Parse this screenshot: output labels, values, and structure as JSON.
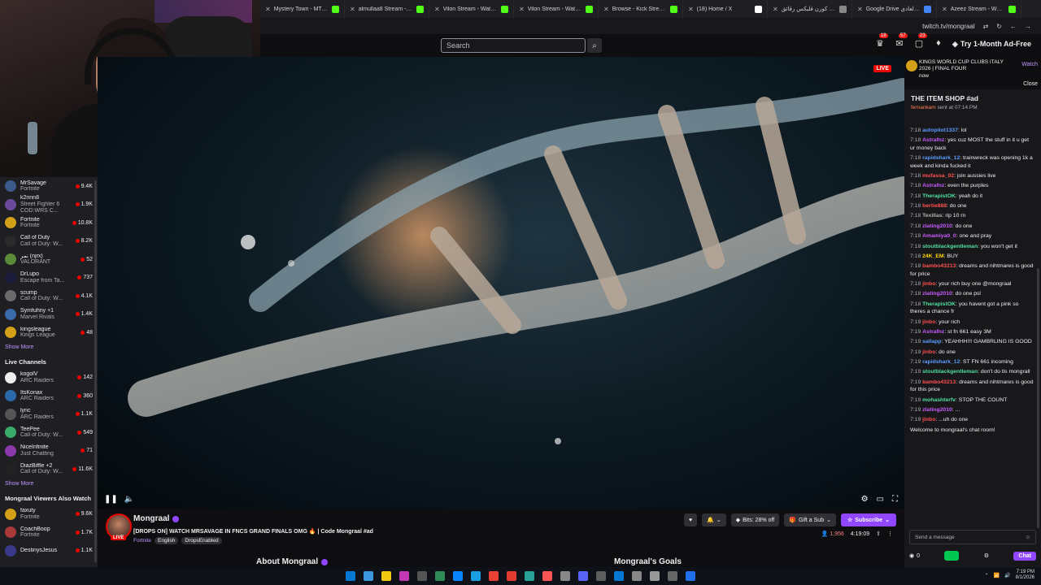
{
  "browser": {
    "tabs": [
      {
        "label": "Mystery Town - MT Studio",
        "color": "#53fc18"
      },
      {
        "label": "almullaa8 Stream - Watch Live",
        "color": "#53fc18"
      },
      {
        "label": "Vilon Stream - Watch Live",
        "color": "#53fc18"
      },
      {
        "label": "Vilon Stream - Watch Live",
        "color": "#53fc18"
      },
      {
        "label": "Browse - Kick Streaming",
        "color": "#53fc18"
      },
      {
        "label": "(18) Home / X",
        "color": "#ffffff"
      },
      {
        "label": "كورنيز كورن فليكس رقائق",
        "color": "#888888"
      },
      {
        "label": "Google Drive منيو العادي",
        "color": "#4285f4"
      },
      {
        "label": "Azeez Stream - Watch Live",
        "color": "#53fc18"
      }
    ],
    "url": "twitch.tv/mongraal"
  },
  "topnav": {
    "search_placeholder": "Search",
    "badge_1": "18",
    "badge_2": "57",
    "badge_3": "23",
    "ad_free_label": "Try 1-Month Ad-Free"
  },
  "sidebar": {
    "followed": [
      {
        "name": "MrSavage",
        "game": "Fortnite",
        "viewers": "9.4K",
        "color": "#3a5a8a"
      },
      {
        "name": "k2nnn8",
        "game": "Street Fighter 6",
        "extra": "COD:WRS C...",
        "viewers": "1.9K",
        "color": "#6a4a9a"
      },
      {
        "name": "Fortnite",
        "game": "Fortnite",
        "viewers": "10.8K",
        "color": "#d4a017"
      },
      {
        "name": "Call of Duty",
        "game": "Call of Duty: W...",
        "viewers": "8.2K",
        "color": "#2a2a2a"
      },
      {
        "name": "نمر (njrx)",
        "game": "VALORANT",
        "viewers": "52",
        "color": "#5a8a3a"
      },
      {
        "name": "DrLupo",
        "game": "Escape from Ta...",
        "viewers": "737",
        "color": "#1a1a3a"
      },
      {
        "name": "scump",
        "game": "Call of Duty: W...",
        "viewers": "4.1K",
        "color": "#6a6a6a"
      },
      {
        "name": "Symfuhny +1",
        "game": "Marvel Rivals",
        "viewers": "1.4K",
        "color": "#3a6aaa"
      },
      {
        "name": "kingsleague",
        "game": "Kings League",
        "viewers": "48",
        "color": "#d4a017"
      }
    ],
    "show_more_1": "Show More",
    "live_channels_heading": "Live Channels",
    "live": [
      {
        "name": "kogolV",
        "game": "ARC Raiders",
        "viewers": "142",
        "color": "#eeeeee"
      },
      {
        "name": "ItsKonax",
        "game": "ARC Raiders",
        "viewers": "360",
        "color": "#2a6aaa"
      },
      {
        "name": "lyric",
        "game": "ARC Raiders",
        "viewers": "1.1K",
        "color": "#555555"
      },
      {
        "name": "TeePee",
        "game": "Call of Duty: W...",
        "viewers": "549",
        "color": "#3aaa6a"
      },
      {
        "name": "NiceInfinite",
        "game": "Just Chatting",
        "viewers": "71",
        "color": "#8a3aaa"
      },
      {
        "name": "DiazBiffle +2",
        "game": "Call of Duty: W...",
        "viewers": "11.6K",
        "color": "#222222"
      }
    ],
    "show_more_2": "Show More",
    "viewers_also_heading": "Mongraal Viewers Also Watch",
    "also": [
      {
        "name": "faxuty",
        "game": "Fortnite",
        "viewers": "9.6K",
        "color": "#d4a017"
      },
      {
        "name": "CoachBoop",
        "game": "Fortnite",
        "viewers": "1.7K",
        "color": "#aa3a3a"
      },
      {
        "name": "DestinysJesus",
        "game": "",
        "viewers": "1.1K",
        "color": "#3a3a8a"
      }
    ]
  },
  "video": {
    "live_label": "LIVE"
  },
  "stream": {
    "channel": "Mongraal",
    "live_label": "LIVE",
    "title": "[DROPS ON] WATCH MRSAVAGE IN FNCS GRAND FINALS OMG 🔥 | Code Mongraal #ad",
    "game": "Fortnite",
    "tags": [
      "English",
      "DropsEnabled"
    ],
    "bits_label": "Bits: 28% off",
    "gift_label": "Gift a Sub",
    "subscribe_label": "Subscribe",
    "viewers": "1,956",
    "uptime": "4:19:09",
    "about_label": "About Mongraal",
    "goals_label": "Mongraal's Goals"
  },
  "chat": {
    "notification_text": "KINGS WORLD CUP CLUBS ITALY 2026 | FINAL FOUR",
    "notification_time": "now",
    "notification_watch": "Watch",
    "notification_close": "Close",
    "pinned_title": "THE ITEM SHOP #ad",
    "pinned_by_user": "fernankam",
    "pinned_by_rest": "sent at 07:14 PM",
    "messages": [
      {
        "time": "7:18",
        "user": "autopilot1337",
        "color": "#5b9bff",
        "text": "lol"
      },
      {
        "time": "7:18",
        "user": "Astrafnz",
        "color": "#c95bff",
        "text": "yes cuz MOST the stuff in it u get ur money back"
      },
      {
        "time": "7:18",
        "user": "rapidshark_12",
        "color": "#5b9bff",
        "text": "trainwreck was opening 1k a week and kinda fucked it"
      },
      {
        "time": "7:18",
        "user": "mufassa_02",
        "color": "#ff4f4f",
        "text": "join aussies live"
      },
      {
        "time": "7:18",
        "user": "Astrafnz",
        "color": "#c95bff",
        "text": "even the purples"
      },
      {
        "time": "7:18",
        "user": "TherapistOK",
        "color": "#4fe0a0",
        "text": "yeah do it"
      },
      {
        "time": "7:18",
        "user": "bertie888",
        "color": "#ff4f4f",
        "text": "do one"
      },
      {
        "time": "7:18",
        "user": "Texillas",
        "color": "#b0b0b0",
        "text": "rip 10 rn"
      },
      {
        "time": "7:18",
        "user": "zlating2010",
        "color": "#c95bff",
        "text": "do one"
      },
      {
        "time": "7:18",
        "user": "Amamiya0_0",
        "color": "#c95bff",
        "text": "one and pray"
      },
      {
        "time": "7:18",
        "user": "stoutblackgentleman",
        "color": "#4fe0a0",
        "text": "you won't get it"
      },
      {
        "time": "7:18",
        "user": "24K_EM",
        "color": "#ffd700",
        "text": "BUY"
      },
      {
        "time": "7:18",
        "user": "bambo43213",
        "color": "#ff4f4f",
        "text": "dreams and nihtmares is good for price"
      },
      {
        "time": "7:18",
        "user": "jinbo",
        "color": "#ff4f4f",
        "text": "your rich buy one @mongraal"
      },
      {
        "time": "7:18",
        "user": "zlating2010",
        "color": "#c95bff",
        "text": "do one psl"
      },
      {
        "time": "7:18",
        "user": "TherapistOK",
        "color": "#4fe0a0",
        "text": "you havent got a pink so theres a chance fr"
      },
      {
        "time": "7:19",
        "user": "jinbo",
        "color": "#ff4f4f",
        "text": "your rich"
      },
      {
        "time": "7:19",
        "user": "Astrafnz",
        "color": "#c95bff",
        "text": "st fn 661 easy 3M"
      },
      {
        "time": "7:19",
        "user": "sallapp",
        "color": "#5b9bff",
        "text": "YEAHHH!!! GAMBRLING IS GOOD"
      },
      {
        "time": "7:19",
        "user": "jinbo",
        "color": "#ff4f4f",
        "text": "do one"
      },
      {
        "time": "7:19",
        "user": "rapidshark_12",
        "color": "#5b9bff",
        "text": "ST FN 661 incoming"
      },
      {
        "time": "7:19",
        "user": "stoutblackgentleman",
        "color": "#4fe0a0",
        "text": "don't do tis mongrall"
      },
      {
        "time": "7:19",
        "user": "bambo43213",
        "color": "#ff4f4f",
        "text": "dreams and nihtmares is good for this price"
      },
      {
        "time": "7:19",
        "user": "mohashterfv",
        "color": "#4fe0a0",
        "text": "STOP THE COUNT"
      },
      {
        "time": "7:19",
        "user": "zlating2010",
        "color": "#c95bff",
        "text": "..."
      },
      {
        "time": "7:19",
        "user": "jinbo",
        "color": "#ff4f4f",
        "text": "...uh do one"
      }
    ],
    "welcome_text": "Welcome to mongraal's chat room!",
    "input_placeholder": "Send a message",
    "points": "0",
    "chat_button": "Chat"
  },
  "taskbar": {
    "time": "7:19 PM",
    "date": "8/1/2026"
  }
}
